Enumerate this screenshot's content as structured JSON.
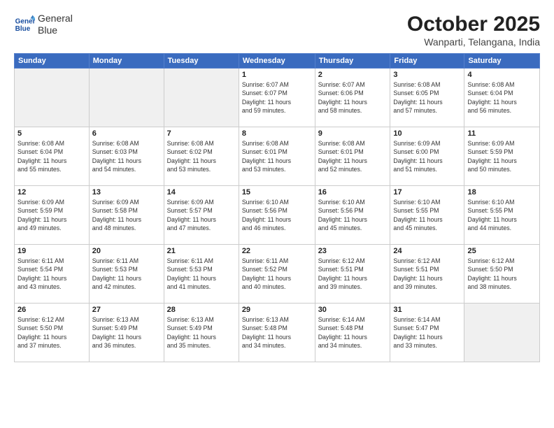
{
  "header": {
    "logo_line1": "General",
    "logo_line2": "Blue",
    "month": "October 2025",
    "location": "Wanparti, Telangana, India"
  },
  "days_of_week": [
    "Sunday",
    "Monday",
    "Tuesday",
    "Wednesday",
    "Thursday",
    "Friday",
    "Saturday"
  ],
  "weeks": [
    [
      {
        "day": "",
        "info": ""
      },
      {
        "day": "",
        "info": ""
      },
      {
        "day": "",
        "info": ""
      },
      {
        "day": "1",
        "info": "Sunrise: 6:07 AM\nSunset: 6:07 PM\nDaylight: 11 hours\nand 59 minutes."
      },
      {
        "day": "2",
        "info": "Sunrise: 6:07 AM\nSunset: 6:06 PM\nDaylight: 11 hours\nand 58 minutes."
      },
      {
        "day": "3",
        "info": "Sunrise: 6:08 AM\nSunset: 6:05 PM\nDaylight: 11 hours\nand 57 minutes."
      },
      {
        "day": "4",
        "info": "Sunrise: 6:08 AM\nSunset: 6:04 PM\nDaylight: 11 hours\nand 56 minutes."
      }
    ],
    [
      {
        "day": "5",
        "info": "Sunrise: 6:08 AM\nSunset: 6:04 PM\nDaylight: 11 hours\nand 55 minutes."
      },
      {
        "day": "6",
        "info": "Sunrise: 6:08 AM\nSunset: 6:03 PM\nDaylight: 11 hours\nand 54 minutes."
      },
      {
        "day": "7",
        "info": "Sunrise: 6:08 AM\nSunset: 6:02 PM\nDaylight: 11 hours\nand 53 minutes."
      },
      {
        "day": "8",
        "info": "Sunrise: 6:08 AM\nSunset: 6:01 PM\nDaylight: 11 hours\nand 53 minutes."
      },
      {
        "day": "9",
        "info": "Sunrise: 6:08 AM\nSunset: 6:01 PM\nDaylight: 11 hours\nand 52 minutes."
      },
      {
        "day": "10",
        "info": "Sunrise: 6:09 AM\nSunset: 6:00 PM\nDaylight: 11 hours\nand 51 minutes."
      },
      {
        "day": "11",
        "info": "Sunrise: 6:09 AM\nSunset: 5:59 PM\nDaylight: 11 hours\nand 50 minutes."
      }
    ],
    [
      {
        "day": "12",
        "info": "Sunrise: 6:09 AM\nSunset: 5:59 PM\nDaylight: 11 hours\nand 49 minutes."
      },
      {
        "day": "13",
        "info": "Sunrise: 6:09 AM\nSunset: 5:58 PM\nDaylight: 11 hours\nand 48 minutes."
      },
      {
        "day": "14",
        "info": "Sunrise: 6:09 AM\nSunset: 5:57 PM\nDaylight: 11 hours\nand 47 minutes."
      },
      {
        "day": "15",
        "info": "Sunrise: 6:10 AM\nSunset: 5:56 PM\nDaylight: 11 hours\nand 46 minutes."
      },
      {
        "day": "16",
        "info": "Sunrise: 6:10 AM\nSunset: 5:56 PM\nDaylight: 11 hours\nand 45 minutes."
      },
      {
        "day": "17",
        "info": "Sunrise: 6:10 AM\nSunset: 5:55 PM\nDaylight: 11 hours\nand 45 minutes."
      },
      {
        "day": "18",
        "info": "Sunrise: 6:10 AM\nSunset: 5:55 PM\nDaylight: 11 hours\nand 44 minutes."
      }
    ],
    [
      {
        "day": "19",
        "info": "Sunrise: 6:11 AM\nSunset: 5:54 PM\nDaylight: 11 hours\nand 43 minutes."
      },
      {
        "day": "20",
        "info": "Sunrise: 6:11 AM\nSunset: 5:53 PM\nDaylight: 11 hours\nand 42 minutes."
      },
      {
        "day": "21",
        "info": "Sunrise: 6:11 AM\nSunset: 5:53 PM\nDaylight: 11 hours\nand 41 minutes."
      },
      {
        "day": "22",
        "info": "Sunrise: 6:11 AM\nSunset: 5:52 PM\nDaylight: 11 hours\nand 40 minutes."
      },
      {
        "day": "23",
        "info": "Sunrise: 6:12 AM\nSunset: 5:51 PM\nDaylight: 11 hours\nand 39 minutes."
      },
      {
        "day": "24",
        "info": "Sunrise: 6:12 AM\nSunset: 5:51 PM\nDaylight: 11 hours\nand 39 minutes."
      },
      {
        "day": "25",
        "info": "Sunrise: 6:12 AM\nSunset: 5:50 PM\nDaylight: 11 hours\nand 38 minutes."
      }
    ],
    [
      {
        "day": "26",
        "info": "Sunrise: 6:12 AM\nSunset: 5:50 PM\nDaylight: 11 hours\nand 37 minutes."
      },
      {
        "day": "27",
        "info": "Sunrise: 6:13 AM\nSunset: 5:49 PM\nDaylight: 11 hours\nand 36 minutes."
      },
      {
        "day": "28",
        "info": "Sunrise: 6:13 AM\nSunset: 5:49 PM\nDaylight: 11 hours\nand 35 minutes."
      },
      {
        "day": "29",
        "info": "Sunrise: 6:13 AM\nSunset: 5:48 PM\nDaylight: 11 hours\nand 34 minutes."
      },
      {
        "day": "30",
        "info": "Sunrise: 6:14 AM\nSunset: 5:48 PM\nDaylight: 11 hours\nand 34 minutes."
      },
      {
        "day": "31",
        "info": "Sunrise: 6:14 AM\nSunset: 5:47 PM\nDaylight: 11 hours\nand 33 minutes."
      },
      {
        "day": "",
        "info": ""
      }
    ]
  ]
}
